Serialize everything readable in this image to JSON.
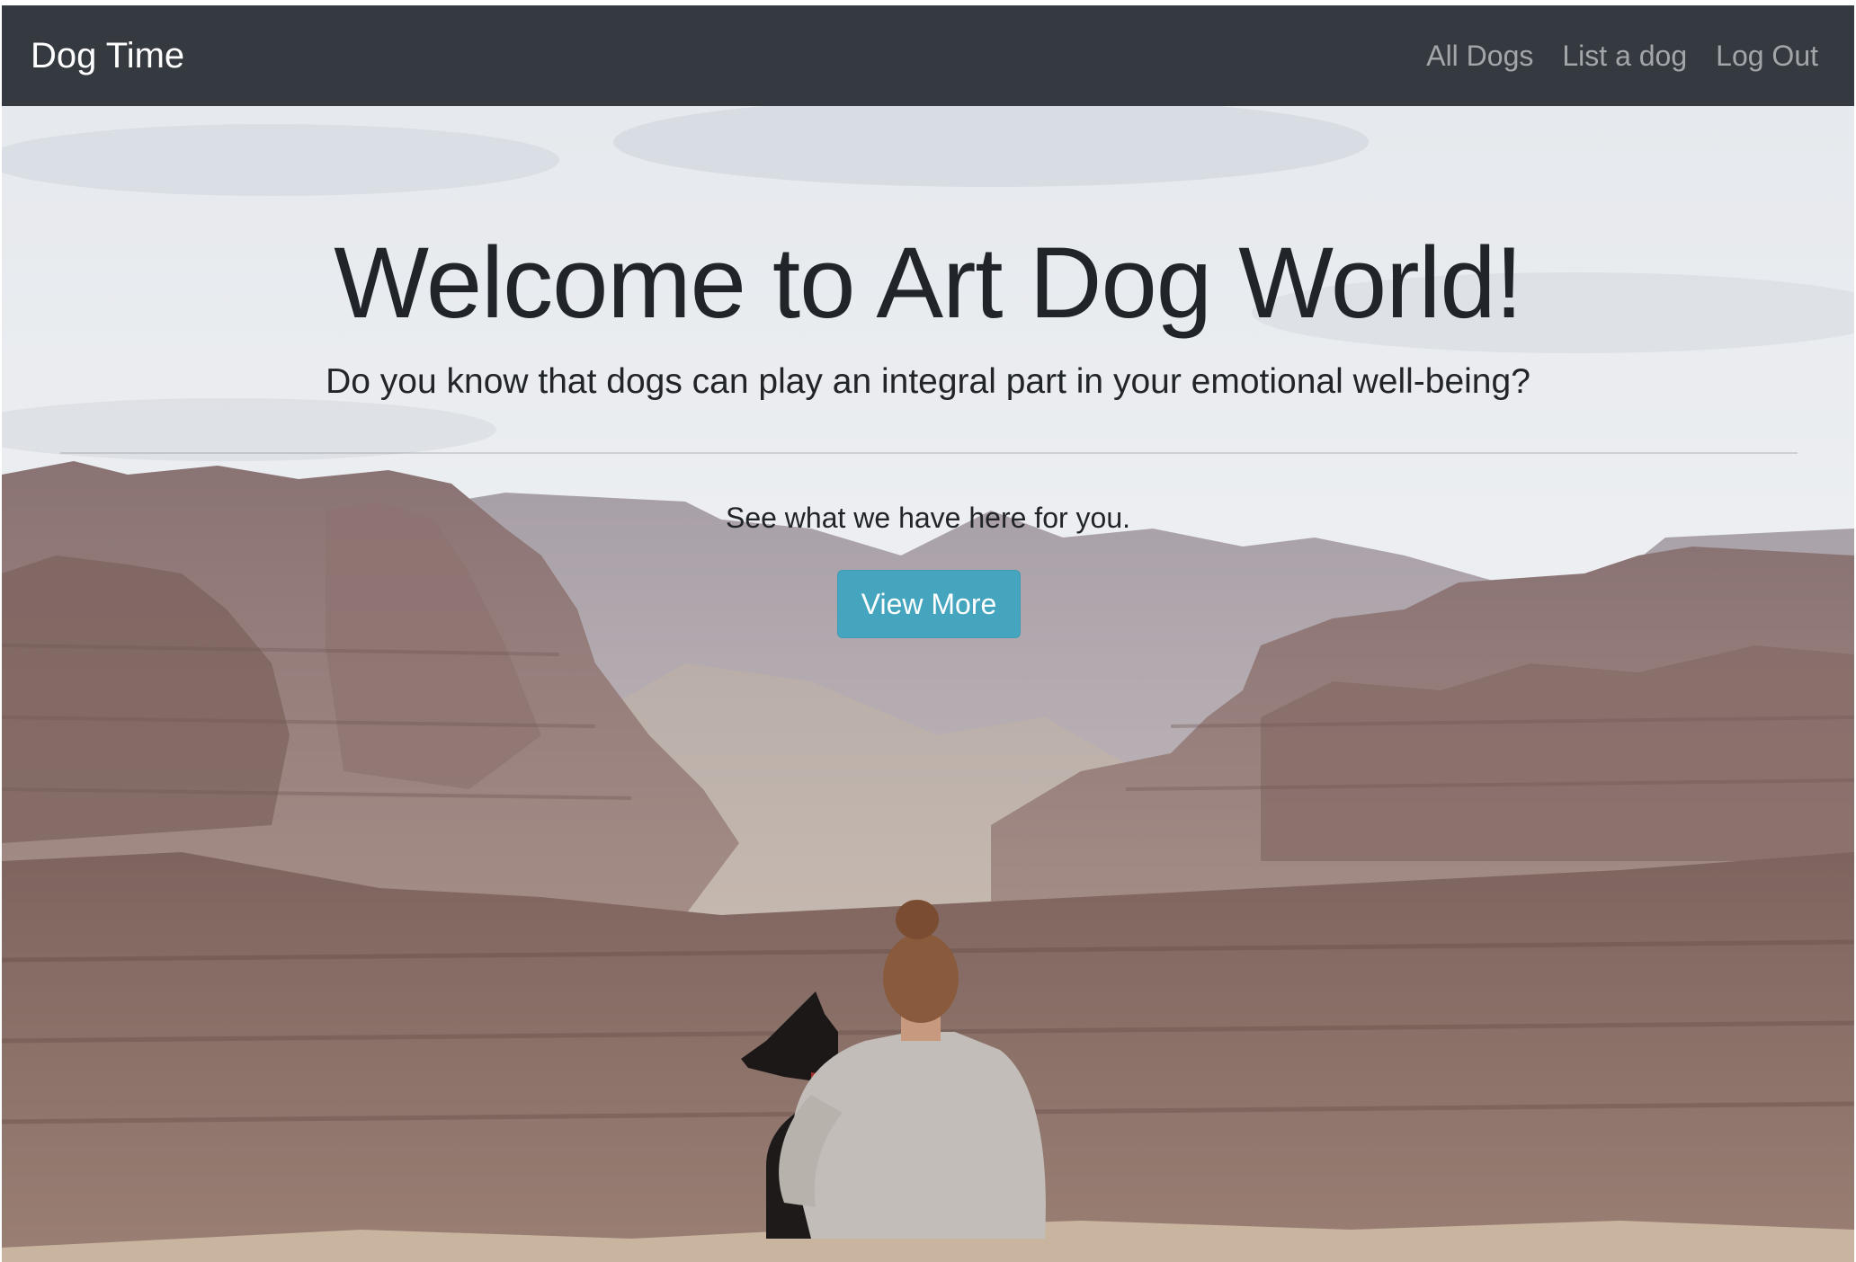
{
  "navbar": {
    "brand": "Dog Time",
    "links": [
      {
        "label": "All Dogs"
      },
      {
        "label": "List a dog"
      },
      {
        "label": "Log Out"
      }
    ]
  },
  "hero": {
    "title": "Welcome to Art Dog World!",
    "lead": "Do you know that dogs can play an integral part in your emotional well-being?",
    "subtext": "See what we have here for you.",
    "button_label": "View More"
  },
  "colors": {
    "navbar_bg": "#343a40",
    "button_bg": "#46a5be",
    "text": "#212529"
  }
}
